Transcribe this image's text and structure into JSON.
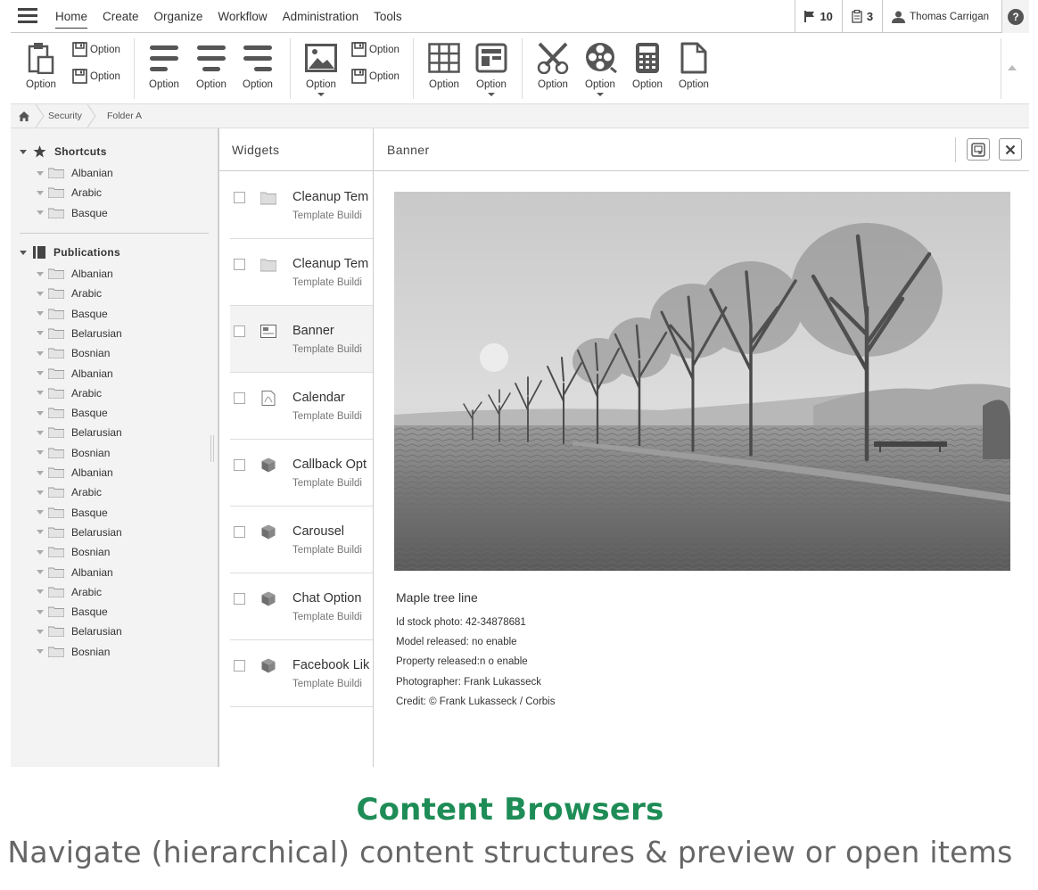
{
  "menubar": {
    "items": [
      "Home",
      "Create",
      "Organize",
      "Workflow",
      "Administration",
      "Tools"
    ],
    "flag_count": "10",
    "task_count": "3",
    "user_name": "Thomas Carrigan"
  },
  "ribbon": {
    "option_label": "Option",
    "big_buttons": [
      "clipboard-icon",
      "align-left-icon",
      "align-center-icon",
      "align-right-icon",
      "image-icon",
      "grid-icon",
      "layout-icon",
      "scissors-icon",
      "film-reel-icon",
      "calculator-icon",
      "document-icon"
    ],
    "small_buttons": [
      "save-icon",
      "save-icon",
      "save-icon",
      "save-icon"
    ]
  },
  "breadcrumb": {
    "items": [
      "Security",
      "Folder A"
    ]
  },
  "tree": {
    "shortcuts": {
      "label": "Shortcuts",
      "items": [
        "Albanian",
        "Arabic",
        "Basque"
      ]
    },
    "publications": {
      "label": "Publications",
      "items": [
        "Albanian",
        "Arabic",
        "Basque",
        "Belarusian",
        "Bosnian",
        "Albanian",
        "Arabic",
        "Basque",
        "Belarusian",
        "Bosnian",
        "Albanian",
        "Arabic",
        "Basque",
        "Belarusian",
        "Bosnian",
        "Albanian",
        "Arabic",
        "Basque",
        "Belarusian",
        "Bosnian"
      ]
    }
  },
  "widgets": {
    "title": "Widgets",
    "rows": [
      {
        "title": "Cleanup Tem",
        "subtitle": "Template Buildi",
        "icon": "folder-icon"
      },
      {
        "title": "Cleanup Tem",
        "subtitle": "Template Buildi",
        "icon": "folder-icon"
      },
      {
        "title": "Banner",
        "subtitle": "Template Buildi",
        "icon": "banner-icon"
      },
      {
        "title": "Calendar",
        "subtitle": "Template Buildi",
        "icon": "pdf-icon"
      },
      {
        "title": "Callback Opt",
        "subtitle": "Template Buildi",
        "icon": "cube-icon"
      },
      {
        "title": "Carousel",
        "subtitle": "Template Buildi",
        "icon": "cube-icon"
      },
      {
        "title": "Chat Option",
        "subtitle": "Template Buildi",
        "icon": "cube-icon"
      },
      {
        "title": "Facebook Lik",
        "subtitle": "Template Buildi",
        "icon": "cube-icon"
      }
    ]
  },
  "banner": {
    "title": "Banner",
    "image_title": "Maple tree line",
    "meta": [
      "Id stock photo: 42-34878681",
      "Model released: no enable",
      "Property released:n o enable",
      "Photographer: Frank Lukasseck",
      "Credit: © Frank Lukasseck / Corbis"
    ]
  },
  "caption": {
    "title": "Content Browsers",
    "subtitle": "Navigate (hierarchical) content structures & preview or open items"
  },
  "colors": {
    "caption_title": "#1e8c56",
    "caption_subtitle": "#666666",
    "panel_bg": "#f3f3f3"
  }
}
